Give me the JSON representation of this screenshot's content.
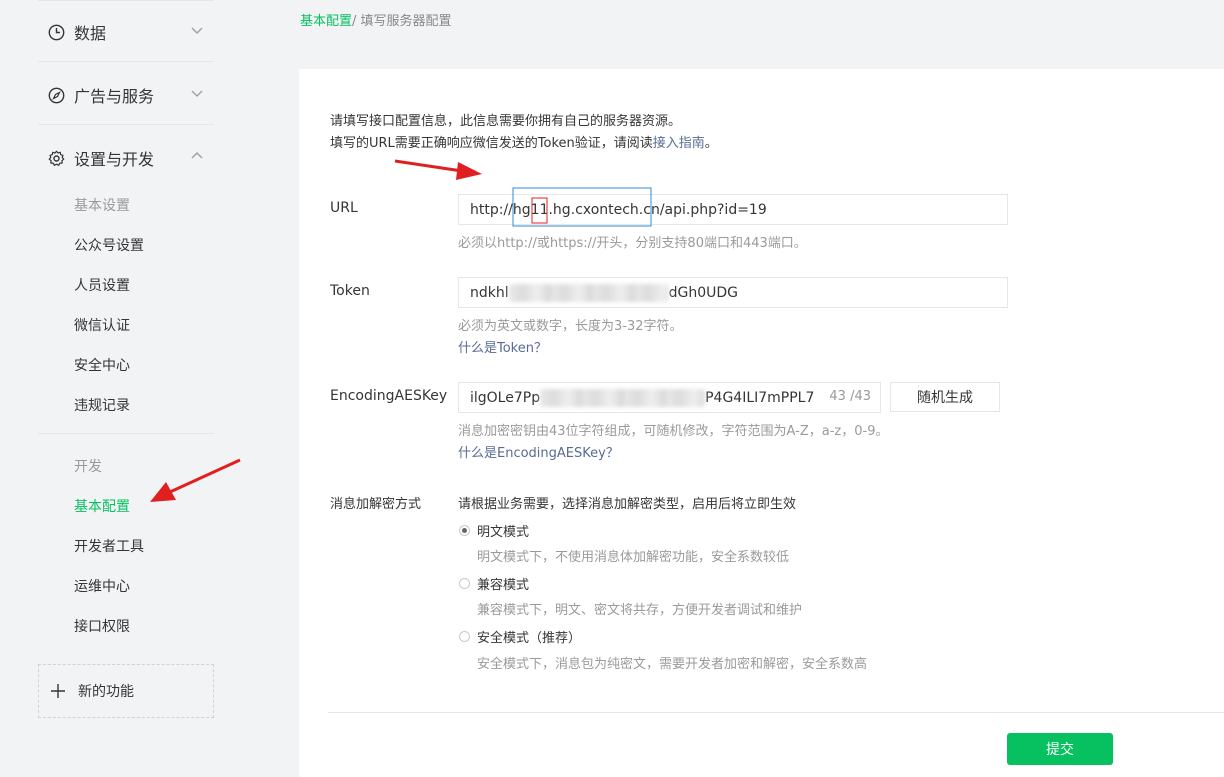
{
  "sidebar": {
    "sections": [
      {
        "label": "数据"
      },
      {
        "label": "广告与服务"
      },
      {
        "label": "设置与开发"
      }
    ],
    "settings_items": [
      "基本设置",
      "公众号设置",
      "人员设置",
      "微信认证",
      "安全中心",
      "违规记录"
    ],
    "dev_group_label": "开发",
    "dev_items": [
      "基本配置",
      "开发者工具",
      "运维中心",
      "接口权限"
    ],
    "new_feature": "新的功能"
  },
  "breadcrumb": {
    "link": "基本配置",
    "separator": "/",
    "current": "填写服务器配置"
  },
  "intro": {
    "line1": "请填写接口配置信息，此信息需要你拥有自己的服务器资源。",
    "line2_prefix": "填写的URL需要正确响应微信发送的Token验证，请阅读",
    "line2_link": "接入指南",
    "line2_suffix": "。"
  },
  "form": {
    "url": {
      "label": "URL",
      "value_prefix": "http://hg",
      "value_mark": "11",
      "value_domain": ".hg.cxontech.cn",
      "value_suffix": "/api.php?id=19",
      "hint": "必须以http://或https://开头，分别支持80端口和443端口。"
    },
    "token": {
      "label": "Token",
      "value_start": "ndkhl",
      "value_end": "dGh0UDG",
      "hint": "必须为英文或数字，长度为3-32字符。",
      "help_link": "什么是Token？"
    },
    "aes": {
      "label": "EncodingAESKey",
      "value_start": "ilgOLe7Pp",
      "value_end": "P4G4ILI7mPPL7",
      "counter": "43 /43",
      "random_button": "随机生成",
      "hint": "消息加密密钥由43位字符组成，可随机修改，字符范围为A-Z，a-z，0-9。",
      "help_link": "什么是EncodingAESKey？"
    },
    "mode": {
      "label": "消息加解密方式",
      "instruction": "请根据业务需要，选择消息加解密类型，启用后将立即生效",
      "options": [
        {
          "label": "明文模式",
          "desc": "明文模式下，不使用消息体加解密功能，安全系数较低",
          "checked": true
        },
        {
          "label": "兼容模式",
          "desc": "兼容模式下，明文、密文将共存，方便开发者调试和维护",
          "checked": false
        },
        {
          "label": "安全模式（推荐）",
          "desc": "安全模式下，消息包为纯密文，需要开发者加密和解密，安全系数高",
          "checked": false
        }
      ]
    },
    "submit": "提交"
  },
  "colors": {
    "accent": "#07c160",
    "link": "#576b95",
    "annotation": "#e02020",
    "highlight_box": "#2d8cd6"
  },
  "icons": [
    "data-clock-icon",
    "compass-icon",
    "gear-icon",
    "chevron-down-icon",
    "chevron-up-icon",
    "plus-icon"
  ]
}
